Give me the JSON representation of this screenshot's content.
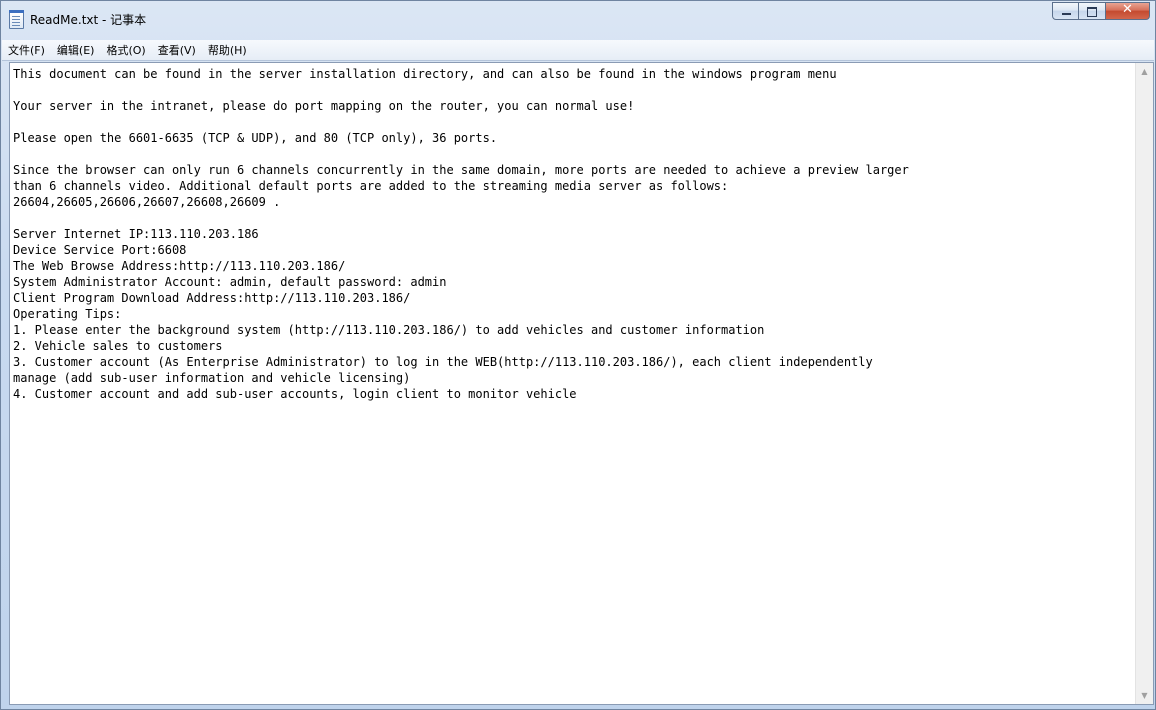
{
  "window": {
    "title": "ReadMe.txt - 记事本",
    "close_glyph": "✕"
  },
  "menu": [
    {
      "label": "文件(F)"
    },
    {
      "label": "编辑(E)"
    },
    {
      "label": "格式(O)"
    },
    {
      "label": "查看(V)"
    },
    {
      "label": "帮助(H)"
    }
  ],
  "document": {
    "lines": [
      "This document can be found in the server installation directory, and can also be found in the windows program menu",
      "",
      "Your server in the intranet, please do port mapping on the router, you can normal use!",
      "",
      "Please open the 6601-6635 (TCP & UDP), and 80 (TCP only), 36 ports.",
      "",
      "Since the browser can only run 6 channels concurrently in the same domain, more ports are needed to achieve a preview larger",
      "than 6 channels video. Additional default ports are added to the streaming media server as follows:",
      "26604,26605,26606,26607,26608,26609 .",
      "",
      "Server Internet IP:113.110.203.186",
      "Device Service Port:6608",
      "The Web Browse Address:http://113.110.203.186/",
      "System Administrator Account: admin, default password: admin",
      "Client Program Download Address:http://113.110.203.186/",
      "Operating Tips:",
      "1. Please enter the background system (http://113.110.203.186/) to add vehicles and customer information",
      "2. Vehicle sales to customers",
      "3. Customer account (As Enterprise Administrator) to log in the WEB(http://113.110.203.186/), each client independently",
      "manage (add sub-user information and vehicle licensing)",
      "4. Customer account and add sub-user accounts, login client to monitor vehicle"
    ]
  },
  "scrollbar": {
    "up_arrow": "▲",
    "down_arrow": "▼"
  }
}
